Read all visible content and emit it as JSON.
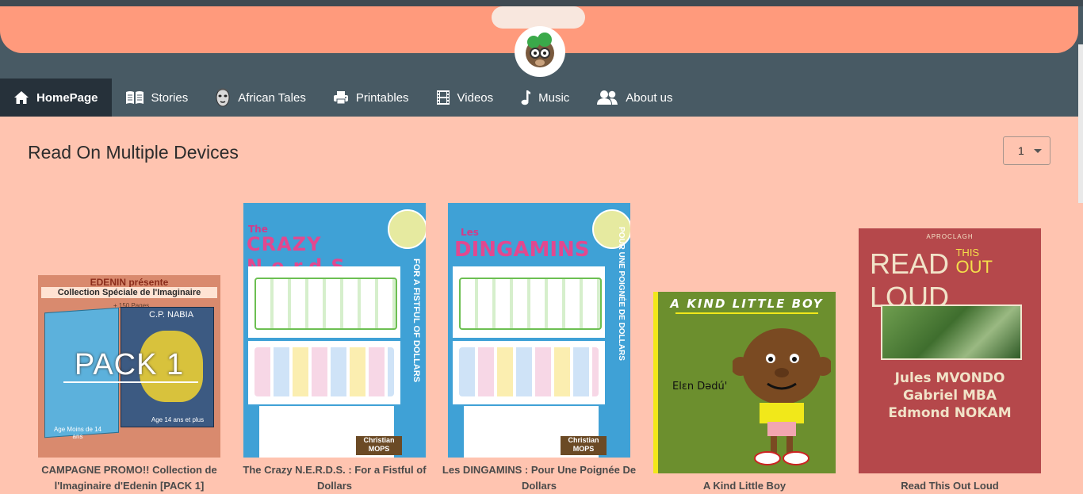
{
  "nav": {
    "items": [
      {
        "label": "HomePage",
        "icon": "home-icon",
        "active": true
      },
      {
        "label": "Stories",
        "icon": "book-open-icon",
        "active": false
      },
      {
        "label": "African Tales",
        "icon": "african-mask-icon",
        "active": false
      },
      {
        "label": "Printables",
        "icon": "printer-icon",
        "active": false
      },
      {
        "label": "Videos",
        "icon": "film-icon",
        "active": false
      },
      {
        "label": "Music",
        "icon": "music-note-icon",
        "active": false
      },
      {
        "label": "About us",
        "icon": "users-icon",
        "active": false
      }
    ]
  },
  "main": {
    "section_title": "Read On Multiple Devices",
    "page_select": {
      "value": "1"
    }
  },
  "books": [
    {
      "caption": "CAMPAGNE PROMO!! Collection de l'Imaginaire d'Edenin [PACK 1]",
      "cover": {
        "top": "EDENIN présente",
        "subtitle": "Collection Spéciale de l'Imaginaire",
        "pages": "+ 150 Pages",
        "big": "PACK 1",
        "author": "C.P. NABIA",
        "age_left": "Age Moins de 14 ans",
        "age_right": "Age 14 ans et plus"
      }
    },
    {
      "caption": "The Crazy N.E.R.D.S. : For a Fistful of Dollars",
      "cover": {
        "prefix": "The",
        "title": "CRAZY N.e.r.d.S.",
        "side": "FOR A FISTFUL OF DOLLARS",
        "badge": "Christian MOPS"
      }
    },
    {
      "caption": "Les DINGAMINS : Pour Une Poignée De Dollars",
      "cover": {
        "prefix": "Les",
        "title": "DINGAMINS",
        "side": "POUR UNE POIGNÉE DE DOLLARS",
        "badge": "Christian MOPS"
      }
    },
    {
      "caption": "A Kind Little Boy",
      "cover": {
        "title": "A KIND LITTLE BOY",
        "author": "Elɛn Dədú'"
      }
    },
    {
      "caption": "Read This Out Loud",
      "cover": {
        "publisher": "APROCLAGH",
        "t1": "READ",
        "t2": "THIS",
        "t3": "OUT",
        "t4": "LOUD",
        "authors": [
          "Jules MVONDO",
          "Gabriel MBA",
          "Edmond NOKAM"
        ]
      }
    }
  ],
  "colors": {
    "banner": "#ff9a7c",
    "nav_bg": "#485a64",
    "nav_active": "#26313a",
    "page_bg": "#ffc4b0"
  }
}
